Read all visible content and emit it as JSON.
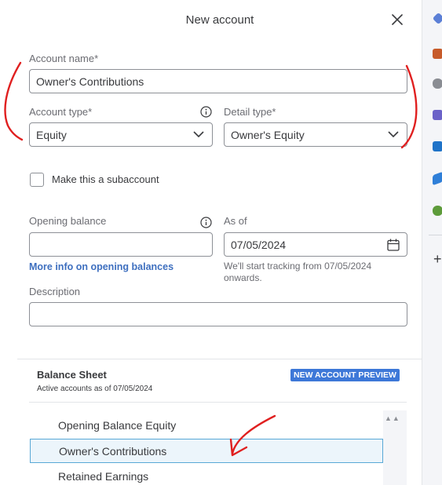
{
  "dialog": {
    "title": "New account",
    "close_icon": "close-icon"
  },
  "form": {
    "account_name_label": "Account name*",
    "account_name_value": "Owner's Contributions",
    "account_type_label": "Account type*",
    "account_type_value": "Equity",
    "detail_type_label": "Detail type*",
    "detail_type_value": "Owner's Equity",
    "subaccount_label": "Make this a subaccount",
    "opening_balance_label": "Opening balance",
    "opening_balance_value": "",
    "as_of_label": "As of",
    "as_of_value": "07/05/2024",
    "more_info_link": "More info on opening balances",
    "tracking_hint": "We'll start tracking from 07/05/2024 onwards.",
    "description_label": "Description",
    "description_value": ""
  },
  "preview": {
    "title": "Balance Sheet",
    "subtitle": "Active accounts as of 07/05/2024",
    "badge": "NEW ACCOUNT PREVIEW",
    "scroll_arrows": "▲▲",
    "rows": [
      "Opening Balance Equity",
      "Owner's Contributions",
      "Retained Earnings"
    ],
    "highlighted_row": "Owner's Contributions"
  },
  "rail": {
    "icons": [
      "diamond-icon",
      "briefcase-icon",
      "people-icon",
      "teams-icon",
      "outlook-icon",
      "send-icon",
      "tree-icon"
    ],
    "plus": "+"
  },
  "colors": {
    "annotation": "#e02020",
    "link": "#3e6fbf",
    "badge": "#3d78d8",
    "highlight_border": "#59a8d6"
  }
}
